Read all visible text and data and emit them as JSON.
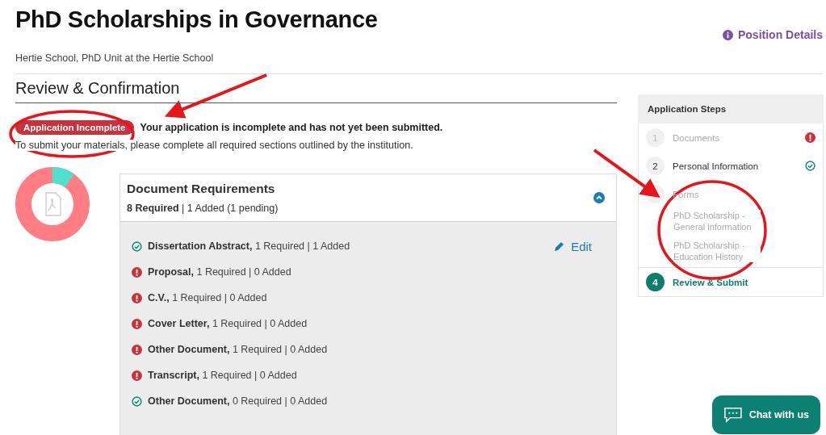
{
  "header": {
    "title": "PhD Scholarships in Governance",
    "subtitle": "Hertie School, PhD Unit at the Hertie School",
    "position_link": "Position Details"
  },
  "section_title": "Review & Confirmation",
  "status": {
    "badge": "Application Incomplete",
    "message": "Your application is incomplete and has not yet been submitted.",
    "note": "To submit your materials, please complete all required sections outlined by the institution."
  },
  "progress": {
    "level": 0.1
  },
  "documents": {
    "title": "Document Requirements",
    "summary": "**8 Required** | 1 Added (1 pending)",
    "expanded": true,
    "edit_label": "Edit",
    "items": [
      {
        "name": "Dissertation Abstract,",
        "detail": "1 Required | 1 Added",
        "kind": "done",
        "editable": true
      },
      {
        "name": "Proposal,",
        "detail": "1 Required | 0 Added",
        "kind": "missing",
        "editable": false
      },
      {
        "name": "C.V.,",
        "detail": "1 Required | 0 Added",
        "kind": "missing",
        "editable": false
      },
      {
        "name": "Cover Letter,",
        "detail": "1 Required | 0 Added",
        "kind": "missing",
        "editable": false
      },
      {
        "name": "Other Document,",
        "detail": "1 Required | 0 Added",
        "kind": "missing",
        "editable": false
      },
      {
        "name": "Transcript,",
        "detail": "1 Required | 0 Added",
        "kind": "missing",
        "editable": false
      },
      {
        "name": "Other Document,",
        "detail": "0 Required | 0 Added",
        "kind": "done",
        "editable": false
      }
    ]
  },
  "steps": {
    "title": "Application Steps",
    "items": [
      {
        "number": "1",
        "label": "Documents",
        "kind": "missing",
        "muted": true,
        "selected": false
      },
      {
        "number": "2",
        "label": "Personal Information",
        "kind": "done",
        "muted": false,
        "selected": false
      },
      {
        "label": "Forms",
        "kind": "plain",
        "muted": true,
        "selected": false,
        "children": [
          {
            "label": "PhD Scholarship - General information"
          },
          {
            "label": "PhD Scholarship - Education History"
          }
        ]
      },
      {
        "number": "4",
        "label": "Review & Submit",
        "kind": "plain",
        "muted": false,
        "selected": true
      }
    ]
  },
  "chat_button": "Chat with us"
}
